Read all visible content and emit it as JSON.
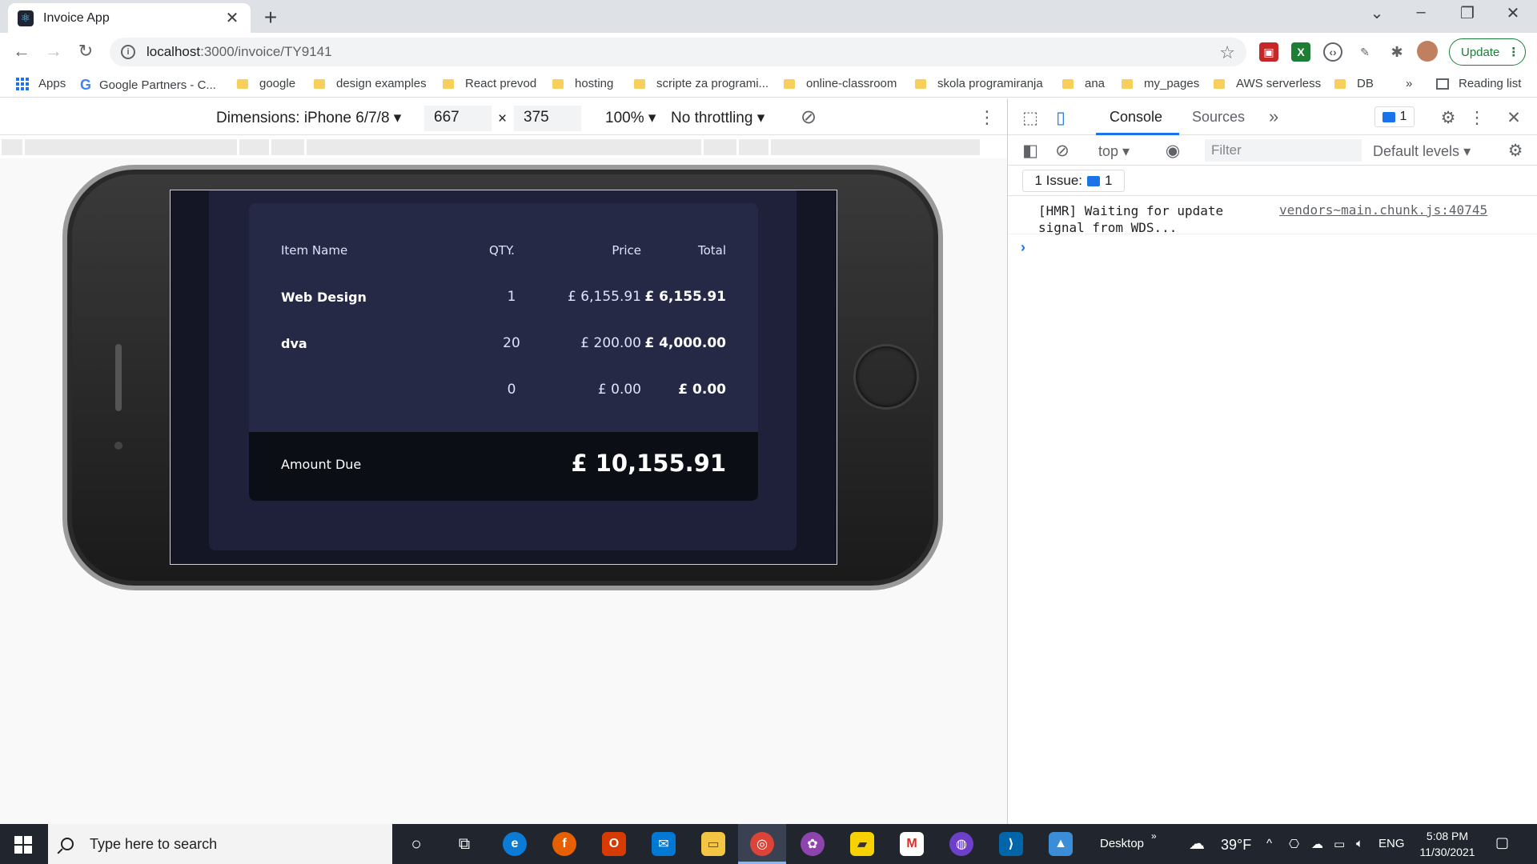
{
  "browser": {
    "tab_title": "Invoice App",
    "url_host": "localhost",
    "url_rest": ":3000/invoice/TY9141",
    "update_label": "Update"
  },
  "bookmarks": [
    "Apps",
    "Google Partners - C...",
    "google",
    "design examples",
    "React prevod",
    "hosting",
    "scripte za programi...",
    "online-classroom",
    "skola programiranja",
    "ana",
    "my_pages",
    "AWS serverless",
    "DB"
  ],
  "bookmarks_overflow": "»",
  "reading_list": "Reading list",
  "device_toolbar": {
    "dimensions": "Dimensions: iPhone 6/7/8",
    "width": "667",
    "times": "×",
    "height": "375",
    "zoom": "100%",
    "throttling": "No throttling"
  },
  "invoice": {
    "headers": {
      "item_name": "Item Name",
      "qty": "QTY.",
      "price": "Price",
      "total": "Total"
    },
    "items": [
      {
        "name": "Web Design",
        "qty": "1",
        "price": "£ 6,155.91",
        "total": "£ 6,155.91"
      },
      {
        "name": "dva",
        "qty": "20",
        "price": "£ 200.00",
        "total": "£ 4,000.00"
      },
      {
        "name": "",
        "qty": "0",
        "price": "£ 0.00",
        "total": "£ 0.00"
      }
    ],
    "amount_due_label": "Amount Due",
    "amount_due_value": "£ 10,155.91"
  },
  "devtools": {
    "tabs": [
      "Console",
      "Sources"
    ],
    "more_tabs": "»",
    "issue_count": "1",
    "context": "top",
    "filter_placeholder": "Filter",
    "levels": "Default levels",
    "issues_label": "1 Issue:",
    "issues_count": "1",
    "console_message": "[HMR] Waiting for update signal from WDS...",
    "console_source": "vendors~main.chunk.js:40745",
    "prompt": "›"
  },
  "taskbar": {
    "search_placeholder": "Type here to search",
    "desktop_label": "Desktop",
    "weather": "39°F",
    "language": "ENG",
    "time": "5:08 PM",
    "date": "11/30/2021"
  },
  "colors": {
    "accent": "#1a73e8",
    "invoice_bg": "#1e2139",
    "items_bg": "#252945",
    "amount_bg": "#0c0e16",
    "page_bg": "#141625"
  }
}
